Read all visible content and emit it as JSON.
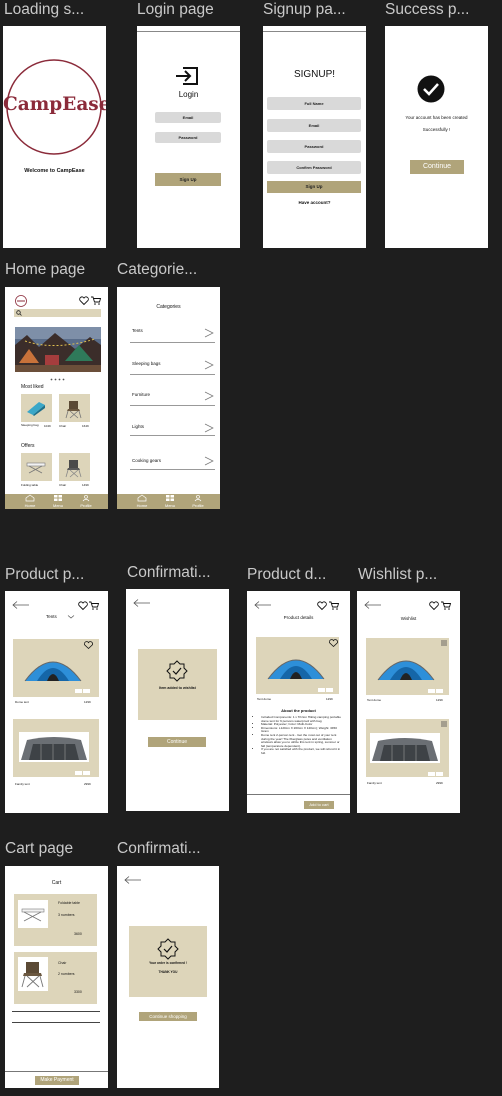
{
  "labels": {
    "loading": "Loading s...",
    "login": "Login page",
    "signup": "Signup pa...",
    "success": "Success p...",
    "home": "Home page",
    "categories": "Categorie...",
    "product": "Product p...",
    "confirm1": "Confirmati...",
    "details": "Product d...",
    "wishlist": "Wishlist p...",
    "cart": "Cart page",
    "confirm2": "Confirmati..."
  },
  "loading": {
    "brand": "CampEase",
    "welcome": "Welcome to CampEase"
  },
  "login": {
    "title": "Login",
    "email": "Email",
    "password": "Password",
    "button": "Sign Up"
  },
  "signup": {
    "title": "SIGNUP!",
    "full_name": "Full Name",
    "email": "Email",
    "password": "Password",
    "confirm": "Confirm Password",
    "button": "Sign Up",
    "have_account": "Have account?"
  },
  "success": {
    "line1": "Your account has been created",
    "line2": "Successfully !",
    "button": "Continue"
  },
  "home": {
    "most_liked": "Most liked",
    "offers": "Offers",
    "items": [
      {
        "name": "Sleeping bag",
        "price": "1049"
      },
      {
        "name": "Chair",
        "price": "1649"
      },
      {
        "name": "Folding table",
        "price": ""
      },
      {
        "name": "Chair",
        "price": "1499"
      }
    ],
    "nav": [
      "Home",
      "Menu",
      "Profile"
    ]
  },
  "categories": {
    "title": "Categories",
    "items": [
      "Tents",
      "Sleeping bags",
      "Furniture",
      "Lights",
      "Cooking gears"
    ]
  },
  "product": {
    "filter": "Tents",
    "items": [
      {
        "name": "Dome tent",
        "price": "1299"
      },
      {
        "name": "Family tent",
        "price": "2999"
      }
    ]
  },
  "confirm1": {
    "message": "Item added to wishlist",
    "button": "Continue"
  },
  "details": {
    "title": "Product details",
    "name": "Tent dome",
    "price": "1299",
    "about": "About the product",
    "bullets": [
      "Included Components: 1 x Trizion Hiking camping portable dome tent for 6 persons waterproof with bag",
      "Material: Polyester; Color: Multi-Color",
      "Dimensions: L120cm X 200cm X 120cm); Weight: 3450 Gram",
      "Dome tent 2-person tent - Get the most out of your tent during the year! The fiberglass poles and ventilation windows allow you to utilize this tent in spring, summer or fall (temperature dependent).",
      "If you are not satisfied with the product, we will refund it in full."
    ],
    "button": "Add to cart"
  },
  "wishlist": {
    "title": "Wishlist",
    "items": [
      {
        "name": "Tent dome",
        "price": "1299"
      },
      {
        "name": "Family tent",
        "price": "2999"
      }
    ]
  },
  "cart": {
    "title": "Cart",
    "items": [
      {
        "name": "Foldable table",
        "qty": "3 numbers",
        "price": "3600"
      },
      {
        "name": "Chair",
        "qty": "2 numbers",
        "price": "3300"
      }
    ],
    "button": "Make Payment"
  },
  "confirm2": {
    "line1": "Your order is confirmed !",
    "line2": "THANK YOU",
    "button": "Continue shopping"
  },
  "colors": {
    "canvas": "#1e1e1e",
    "accent": "#b0a47a",
    "beige": "#ddd5ba",
    "brand": "#8b2b3a"
  }
}
